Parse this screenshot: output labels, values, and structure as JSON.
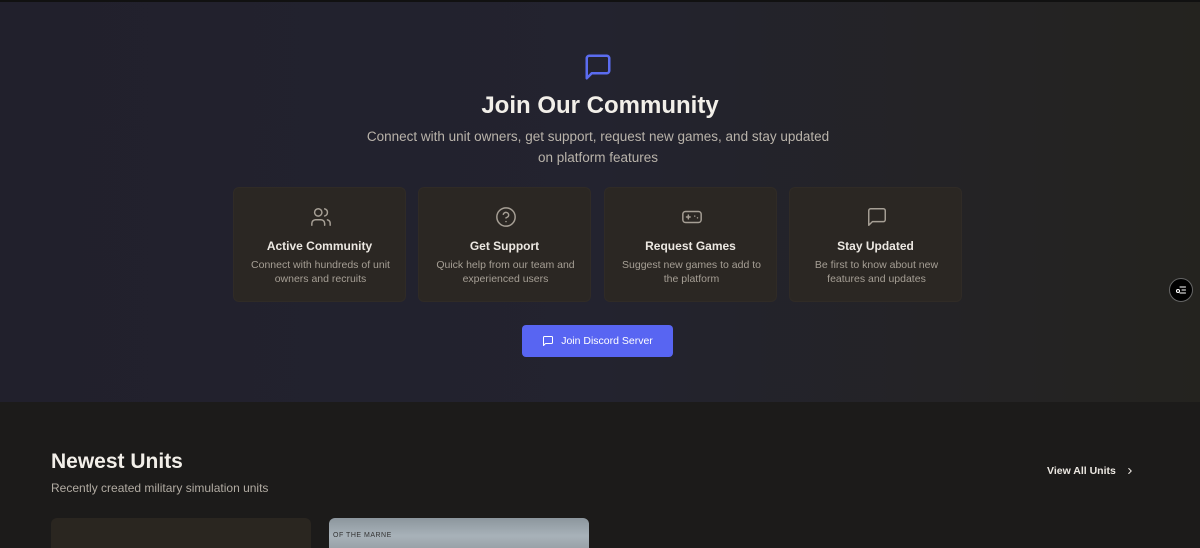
{
  "community": {
    "title": "Join Our Community",
    "subtitle": "Connect with unit owners, get support, request new games, and stay updated on platform features",
    "cards": [
      {
        "icon": "users-icon",
        "title": "Active Community",
        "description": "Connect with hundreds of unit owners and recruits"
      },
      {
        "icon": "help-circle-icon",
        "title": "Get Support",
        "description": "Quick help from our team and experienced users"
      },
      {
        "icon": "gamepad-icon",
        "title": "Request Games",
        "description": "Suggest new games to add to the platform"
      },
      {
        "icon": "message-icon",
        "title": "Stay Updated",
        "description": "Be first to know about new features and updates"
      }
    ],
    "button_label": "Join Discord Server"
  },
  "newest": {
    "title": "Newest Units",
    "subtitle": "Recently created military simulation units",
    "view_all_label": "View All Units",
    "cards": [
      {
        "image_caption": ""
      },
      {
        "image_caption": "OF THE MARNE"
      }
    ]
  },
  "colors": {
    "accent": "#5865f2",
    "card_bg": "#2b2723"
  }
}
